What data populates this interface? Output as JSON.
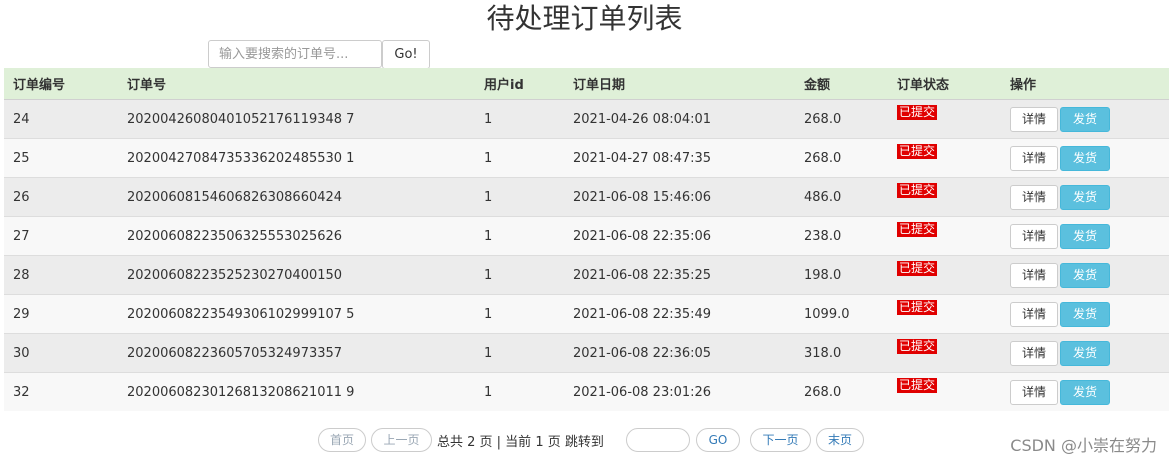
{
  "page": {
    "title": "待处理订单列表"
  },
  "search": {
    "placeholder": "输入要搜索的订单号...",
    "button_label": "Go!"
  },
  "table": {
    "headers": [
      "订单编号",
      "订单号",
      "用户id",
      "订单日期",
      "金额",
      "订单状态",
      "操作"
    ],
    "rows": [
      {
        "id": "24",
        "order_no": "20200426080401052176119348 7",
        "user_id": "1",
        "date": "2021-04-26 08:04:01",
        "amount": "268.0",
        "status": "已提交"
      },
      {
        "id": "25",
        "order_no": "20200427084735336202485530 1",
        "user_id": "1",
        "date": "2021-04-27 08:47:35",
        "amount": "268.0",
        "status": "已提交"
      },
      {
        "id": "26",
        "order_no": "20200608154606826308660424",
        "user_id": "1",
        "date": "2021-06-08 15:46:06",
        "amount": "486.0",
        "status": "已提交"
      },
      {
        "id": "27",
        "order_no": "20200608223506325553025626",
        "user_id": "1",
        "date": "2021-06-08 22:35:06",
        "amount": "238.0",
        "status": "已提交"
      },
      {
        "id": "28",
        "order_no": "20200608223525230270400150",
        "user_id": "1",
        "date": "2021-06-08 22:35:25",
        "amount": "198.0",
        "status": "已提交"
      },
      {
        "id": "29",
        "order_no": "20200608223549306102999107 5",
        "user_id": "1",
        "date": "2021-06-08 22:35:49",
        "amount": "1099.0",
        "status": "已提交"
      },
      {
        "id": "30",
        "order_no": "20200608223605705324973357",
        "user_id": "1",
        "date": "2021-06-08 22:36:05",
        "amount": "318.0",
        "status": "已提交"
      },
      {
        "id": "32",
        "order_no": "20200608230126813208621011 9",
        "user_id": "1",
        "date": "2021-06-08 23:01:26",
        "amount": "268.0",
        "status": "已提交"
      }
    ],
    "detail_label": "详情",
    "ship_label": "发货",
    "status_color": "#e00000",
    "ship_color": "#5bc0de",
    "header_bg": "#dff0d8"
  },
  "pager": {
    "first": "首页",
    "prev": "上一页",
    "info": "总共 2 页 | 当前 1 页 跳转到",
    "go": "GO",
    "next": "下一页",
    "last": "末页"
  },
  "watermark": "CSDN @小崇在努力"
}
